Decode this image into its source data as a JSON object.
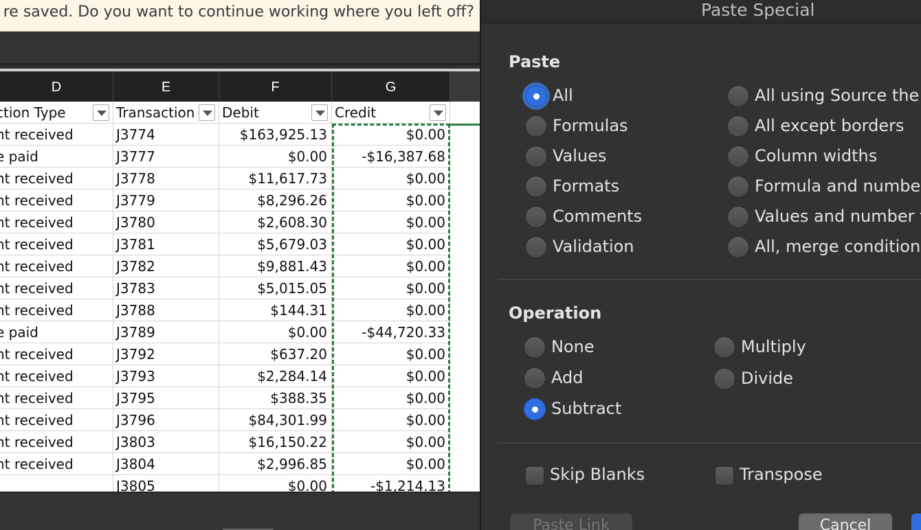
{
  "notice": {
    "text": "re saved. Do you want to continue working where you left off?"
  },
  "sheet": {
    "columns": [
      {
        "letter": "D",
        "header": "ction Type"
      },
      {
        "letter": "E",
        "header": "Transaction"
      },
      {
        "letter": "F",
        "header": "Debit"
      },
      {
        "letter": "G",
        "header": "Credit"
      }
    ],
    "rows": [
      {
        "type": "nt received",
        "id": "J3774",
        "debit": "$163,925.13",
        "credit": "$0.00"
      },
      {
        "type": "e paid",
        "id": "J3777",
        "debit": "$0.00",
        "credit": "-$16,387.68"
      },
      {
        "type": "nt received",
        "id": "J3778",
        "debit": "$11,617.73",
        "credit": "$0.00"
      },
      {
        "type": "nt received",
        "id": "J3779",
        "debit": "$8,296.26",
        "credit": "$0.00"
      },
      {
        "type": "nt received",
        "id": "J3780",
        "debit": "$2,608.30",
        "credit": "$0.00"
      },
      {
        "type": "nt received",
        "id": "J3781",
        "debit": "$5,679.03",
        "credit": "$0.00"
      },
      {
        "type": "nt received",
        "id": "J3782",
        "debit": "$9,881.43",
        "credit": "$0.00"
      },
      {
        "type": "nt received",
        "id": "J3783",
        "debit": "$5,015.05",
        "credit": "$0.00"
      },
      {
        "type": "nt received",
        "id": "J3788",
        "debit": "$144.31",
        "credit": "$0.00"
      },
      {
        "type": "e paid",
        "id": "J3789",
        "debit": "$0.00",
        "credit": "-$44,720.33"
      },
      {
        "type": "nt received",
        "id": "J3792",
        "debit": "$637.20",
        "credit": "$0.00"
      },
      {
        "type": "nt received",
        "id": "J3793",
        "debit": "$2,284.14",
        "credit": "$0.00"
      },
      {
        "type": "nt received",
        "id": "J3795",
        "debit": "$388.35",
        "credit": "$0.00"
      },
      {
        "type": "nt received",
        "id": "J3796",
        "debit": "$84,301.99",
        "credit": "$0.00"
      },
      {
        "type": "nt received",
        "id": "J3803",
        "debit": "$16,150.22",
        "credit": "$0.00"
      },
      {
        "type": "nt received",
        "id": "J3804",
        "debit": "$2,996.85",
        "credit": "$0.00"
      },
      {
        "type": "",
        "id": "J3805",
        "debit": "$0.00",
        "credit": "-$1,214.13"
      }
    ]
  },
  "dialog": {
    "title": "Paste Special",
    "paste": {
      "label": "Paste",
      "left": [
        "All",
        "Formulas",
        "Values",
        "Formats",
        "Comments",
        "Validation"
      ],
      "right": [
        "All using Source the",
        "All except borders",
        "Column widths",
        "Formula and number",
        "Values and number f",
        "All, merge conditiona"
      ],
      "selected": "All"
    },
    "operation": {
      "label": "Operation",
      "left": [
        "None",
        "Add",
        "Subtract"
      ],
      "right": [
        "Multiply",
        "Divide"
      ],
      "selected": "Subtract"
    },
    "checks": {
      "skip_blanks": "Skip Blanks",
      "transpose": "Transpose"
    },
    "buttons": {
      "paste_link": "Paste Link",
      "cancel": "Cancel"
    },
    "colors": {
      "accent": "#2f6fe0",
      "marquee": "#2e7d42"
    }
  }
}
